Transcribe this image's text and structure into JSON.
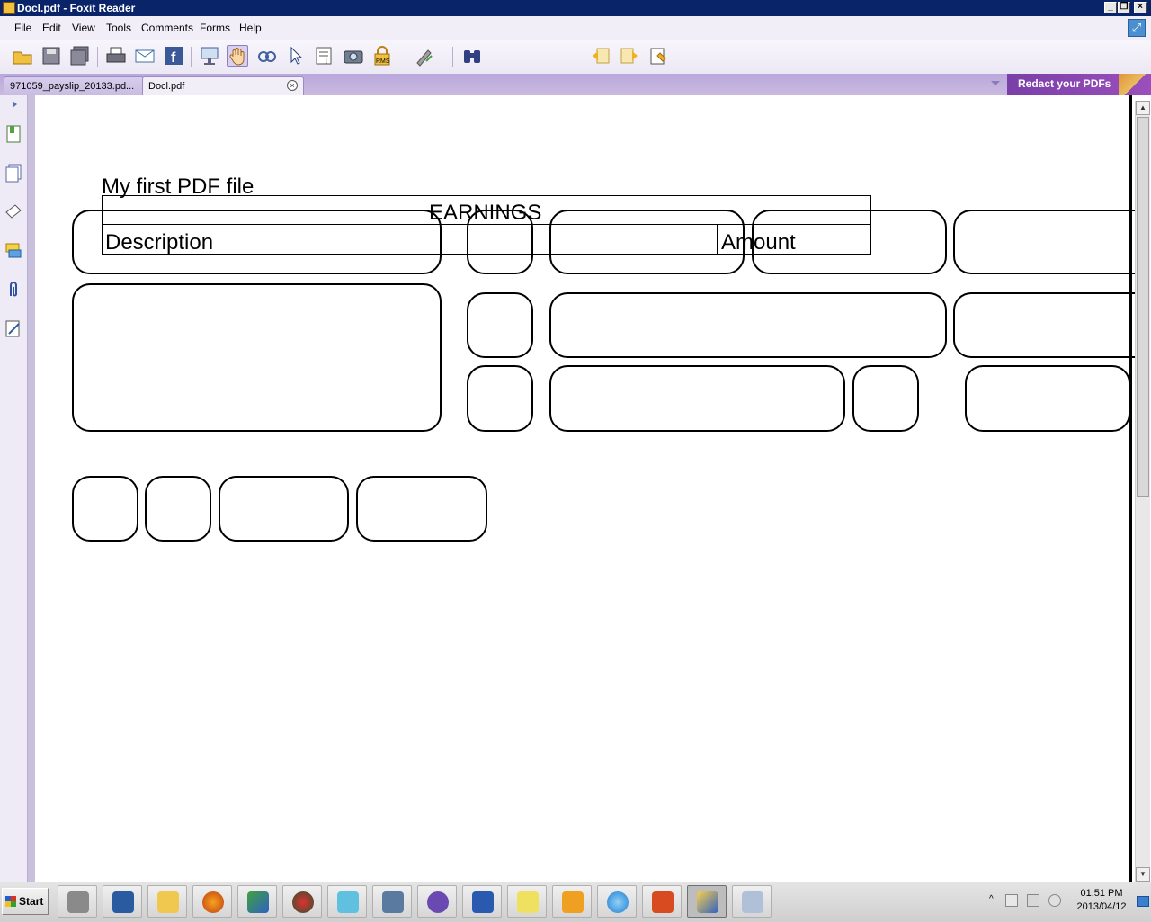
{
  "window": {
    "title": "Docl.pdf - Foxit Reader"
  },
  "menu": {
    "items": [
      "File",
      "Edit",
      "View",
      "Tools",
      "Comments",
      "Forms",
      "Help"
    ]
  },
  "toolbar": {
    "icons": [
      "open-icon",
      "save-icon",
      "save-all-icon",
      "print-icon",
      "email-icon",
      "facebook-icon",
      "presentation-icon",
      "hand-tool-icon",
      "snapshot-zoom-icon",
      "select-icon",
      "text-select-icon",
      "camera-icon",
      "rms-lock-icon",
      "sign-icon",
      "find-binoculars-icon",
      "find-previous-icon",
      "find-next-icon",
      "find-options-icon"
    ],
    "find_value": ""
  },
  "tabs": [
    {
      "label": "971059_payslip_20133.pd...",
      "active": false
    },
    {
      "label": "Docl.pdf",
      "active": true
    }
  ],
  "banner": {
    "label": "Redact your PDFs"
  },
  "document": {
    "title": "My first PDF file",
    "table": {
      "header": "EARNINGS",
      "col1": "Description",
      "col2": "Amount"
    }
  },
  "taskbar": {
    "start_label": "Start",
    "apps": [
      "server-manager-icon",
      "powershell-icon",
      "explorer-icon",
      "firefox-icon",
      "network-icon",
      "tool-icon",
      "bug-icon",
      "remote-desktop-icon",
      "infinity-icon",
      "word-icon",
      "help-icon",
      "outlook-icon",
      "ie-icon",
      "powerpoint-icon",
      "foxit-icon",
      "calculator-icon"
    ],
    "clock_time": "01:51 PM",
    "clock_date": "2013/04/12"
  }
}
